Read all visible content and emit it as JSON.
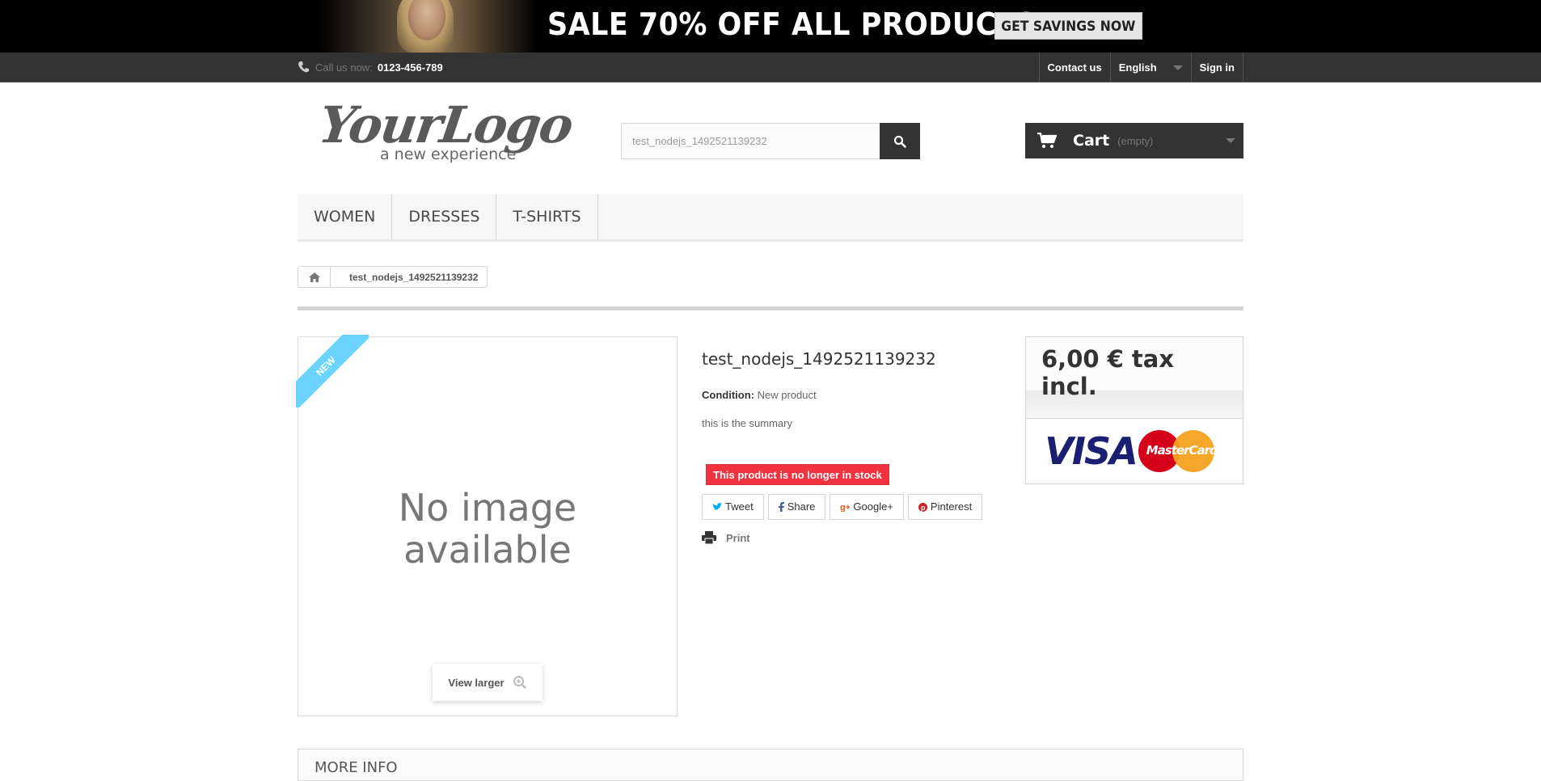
{
  "banner": {
    "title": "SALE 70% OFF ALL PRODUCTS",
    "cta": "GET SAVINGS NOW"
  },
  "topbar": {
    "call_label": "Call us now:",
    "phone": "0123-456-789",
    "contact": "Contact us",
    "language": "English",
    "signin": "Sign in"
  },
  "header": {
    "logo_main": "YourLogo",
    "logo_sub": "a new experience",
    "search_value": "test_nodejs_1492521139232",
    "cart_label": "Cart",
    "cart_status": "(empty)"
  },
  "menu": {
    "items": [
      "WOMEN",
      "DRESSES",
      "T-SHIRTS"
    ]
  },
  "breadcrumb": {
    "current": "test_nodejs_1492521139232"
  },
  "product": {
    "badge": "NEW",
    "no_image": "No image available",
    "view_larger": "View larger",
    "title": "test_nodejs_1492521139232",
    "condition_label": "Condition:",
    "condition_value": "New product",
    "summary": "this is the summary",
    "stock_status": "This product is no longer in stock",
    "social": {
      "tweet": "Tweet",
      "share": "Share",
      "google": "Google+",
      "pinterest": "Pinterest"
    },
    "print": "Print",
    "price": "6,00 € tax incl.",
    "card_visa": "VISA",
    "card_mc": "MasterCard"
  },
  "more_info": "MORE INFO",
  "colors": {
    "accent_dark": "#333333",
    "stock_red": "#f13340",
    "ribbon_blue": "#6ad4ff"
  }
}
